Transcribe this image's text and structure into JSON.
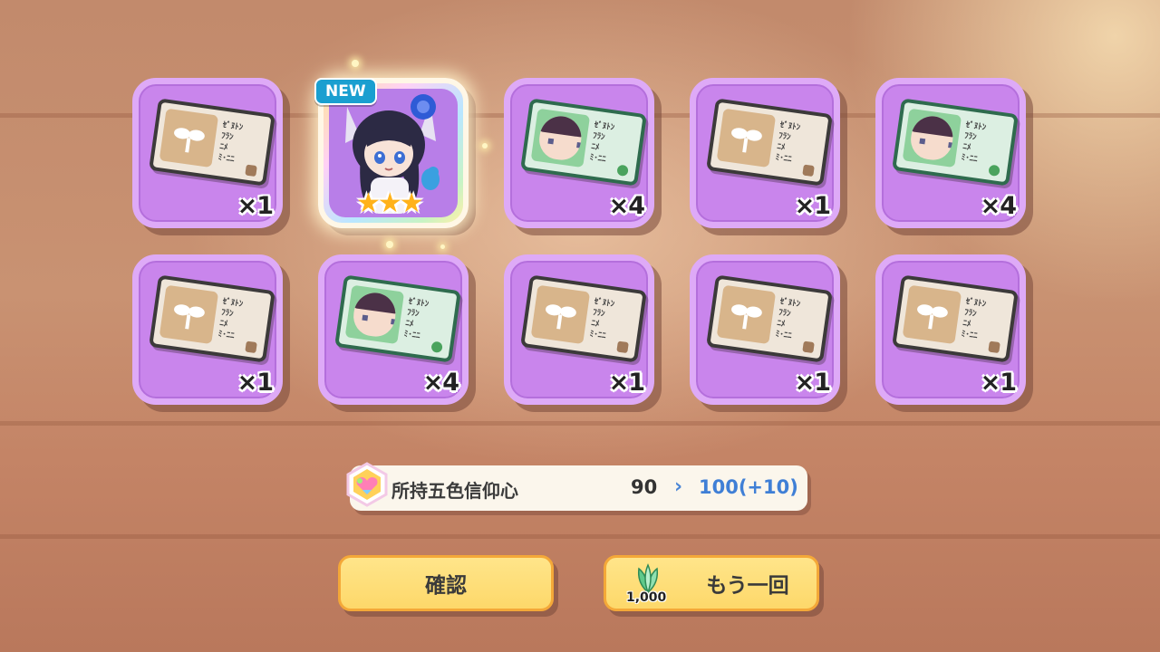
{
  "rewards": [
    {
      "kind": "seed-ticket",
      "quantity": "×1"
    },
    {
      "kind": "character",
      "badge": "NEW",
      "stars": "★★★"
    },
    {
      "kind": "portrait-ticket",
      "quantity": "×4"
    },
    {
      "kind": "seed-ticket",
      "quantity": "×1"
    },
    {
      "kind": "portrait-ticket",
      "quantity": "×4"
    },
    {
      "kind": "seed-ticket",
      "quantity": "×1"
    },
    {
      "kind": "portrait-ticket",
      "quantity": "×4"
    },
    {
      "kind": "seed-ticket",
      "quantity": "×1"
    },
    {
      "kind": "seed-ticket",
      "quantity": "×1"
    },
    {
      "kind": "seed-ticket",
      "quantity": "×1"
    }
  ],
  "ticket_text": [
    "ｾﾞﾇﾄﾝ",
    "ﾌﾗﾝ",
    "ﾆﾒ",
    "ﾐ･ﾆﾆ"
  ],
  "faith": {
    "label": "所持五色信仰心",
    "old_value": "90",
    "arrow": "›",
    "new_value": "100(+10)"
  },
  "buttons": {
    "confirm_label": "確認",
    "again_label": "もう一回",
    "again_cost": "1,000"
  },
  "colors": {
    "tile": "#c985ec",
    "button": "#fdd86a",
    "accent_blue": "#3f7fd6",
    "new_badge": "#1a9fd0"
  }
}
